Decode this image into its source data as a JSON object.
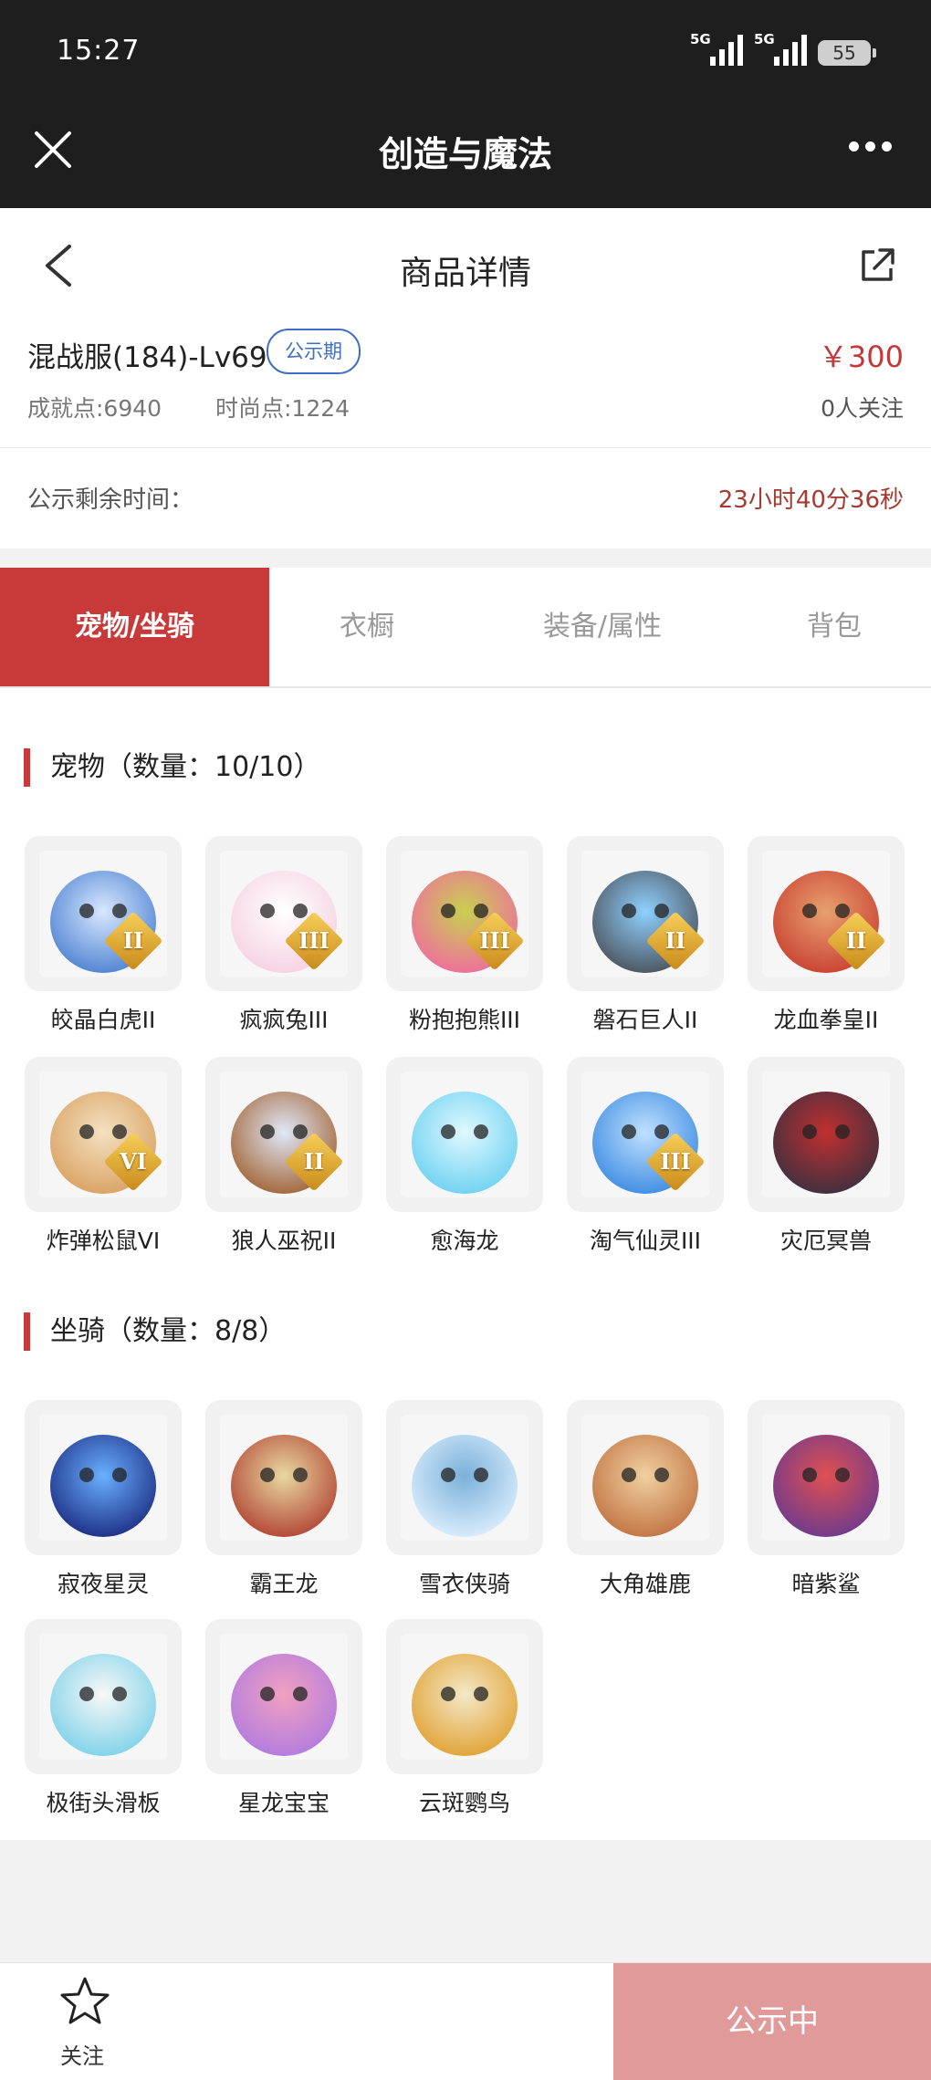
{
  "status_bar": {
    "time": "15:27",
    "signal1_label": "5G",
    "signal2_label": "5G",
    "battery": "55"
  },
  "titlebar": {
    "title": "创造与魔法"
  },
  "navbar": {
    "title": "商品详情"
  },
  "listing": {
    "server": "混战服(184)-Lv69",
    "badge": "公示期",
    "price": "￥300",
    "achievement": "成就点:6940",
    "fashion": "时尚点:1224",
    "follows": "0人关注"
  },
  "timer": {
    "label": "公示剩余时间：",
    "value": "23小时40分36秒"
  },
  "tabs": [
    {
      "label": "宠物/坐骑",
      "active": true
    },
    {
      "label": "衣橱",
      "active": false
    },
    {
      "label": "装备/属性",
      "active": false
    },
    {
      "label": "背包",
      "active": false
    }
  ],
  "sections": {
    "pets_title": "宠物（数量：10/10）",
    "mounts_title": "坐骑（数量：8/8）"
  },
  "pets": [
    {
      "name": "皎晶白虎II",
      "tier": "II",
      "colors": [
        "#4a7fd0",
        "#d8e8ff"
      ]
    },
    {
      "name": "疯疯兔III",
      "tier": "III",
      "colors": [
        "#f5d0e0",
        "#ffffff"
      ]
    },
    {
      "name": "粉抱抱熊III",
      "tier": "III",
      "colors": [
        "#f06aa0",
        "#c8d050"
      ]
    },
    {
      "name": "磐石巨人II",
      "tier": "II",
      "colors": [
        "#4a5058",
        "#8fd0ff"
      ]
    },
    {
      "name": "龙血拳皇II",
      "tier": "II",
      "colors": [
        "#c84030",
        "#e8a070"
      ]
    },
    {
      "name": "炸弹松鼠VI",
      "tier": "VI",
      "colors": [
        "#d8a060",
        "#f4e0c0"
      ]
    },
    {
      "name": "狼人巫祝II",
      "tier": "II",
      "colors": [
        "#a06030",
        "#e0e8f8"
      ]
    },
    {
      "name": "愈海龙",
      "tier": "",
      "colors": [
        "#6ad0f0",
        "#e0f8ff"
      ]
    },
    {
      "name": "淘气仙灵III",
      "tier": "III",
      "colors": [
        "#3a8ae0",
        "#bfe0ff"
      ]
    },
    {
      "name": "灾厄冥兽",
      "tier": "",
      "colors": [
        "#3a3040",
        "#c03030"
      ]
    }
  ],
  "mounts": [
    {
      "name": "寂夜星灵",
      "colors": [
        "#1a2a80",
        "#6ab0ff"
      ]
    },
    {
      "name": "霸王龙",
      "colors": [
        "#b04030",
        "#e8d8a0"
      ]
    },
    {
      "name": "雪衣侠骑",
      "colors": [
        "#dff0ff",
        "#7ab0d8"
      ]
    },
    {
      "name": "大角雄鹿",
      "colors": [
        "#c07040",
        "#f0d0a0"
      ]
    },
    {
      "name": "暗紫鲨",
      "colors": [
        "#6a3a90",
        "#e05050"
      ]
    },
    {
      "name": "极街头滑板",
      "colors": [
        "#7ad0e8",
        "#f8f8f8"
      ]
    },
    {
      "name": "星龙宝宝",
      "colors": [
        "#b07ae0",
        "#f0a0c0"
      ]
    },
    {
      "name": "云斑鹦鸟",
      "colors": [
        "#e0a030",
        "#f4e8c8"
      ]
    }
  ],
  "bottom": {
    "follow_label": "关注",
    "action_label": "公示中"
  },
  "colors": {
    "accent": "#c8393a",
    "badge_blue": "#3f6fc0",
    "price_red": "#c4383a",
    "action_disabled": "#e09a9a"
  }
}
